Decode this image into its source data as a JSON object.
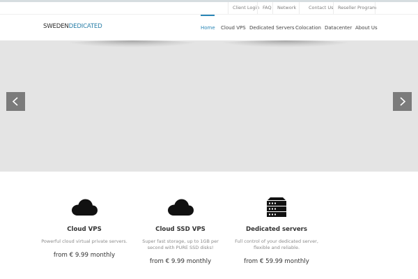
{
  "topbar": {
    "links": [
      {
        "label": "Client Login"
      },
      {
        "label": "FAQ"
      },
      {
        "label": "Network"
      },
      {
        "label": "Contact Us"
      },
      {
        "label": "Reseller Program"
      }
    ]
  },
  "logo": {
    "part1": "SWEDEN",
    "part2": "DEDICATED"
  },
  "nav": {
    "items": [
      {
        "label": "Home",
        "active": true
      },
      {
        "label": "Cloud VPS"
      },
      {
        "label": "Dedicated Servers"
      },
      {
        "label": "Colocation"
      },
      {
        "label": "Datacenter"
      },
      {
        "label": "About Us"
      }
    ]
  },
  "slider": {
    "prev_icon": "chevron-left-icon",
    "next_icon": "chevron-right-icon"
  },
  "features": [
    {
      "icon": "cloud-icon",
      "title": "Cloud VPS",
      "desc": "Powerful cloud virtual private servers.",
      "price": "from € 9.99 monthly"
    },
    {
      "icon": "cloud-icon",
      "title": "Cloud SSD VPS",
      "desc": "Super fast storage, up to 1GB per second with PURE SSD disks!",
      "price": "from € 9.99 monthly"
    },
    {
      "icon": "server-rack-icon",
      "title": "Dedicated servers",
      "desc": "Full control of your dedicated server, flexible and reliable.",
      "price": "from € 59.99 monthly"
    }
  ],
  "colors": {
    "accent": "#2a86b6",
    "logo_accent": "#2a7fa8",
    "slider_bg": "#e4e4e4",
    "arrow_bg": "#7b7b7b"
  }
}
